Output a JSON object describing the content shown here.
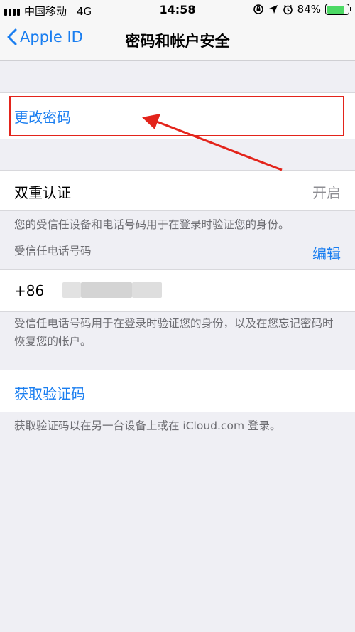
{
  "status_bar": {
    "carrier": "中国移动",
    "network": "4G",
    "time": "14:58",
    "battery_percent": "84%",
    "battery_level": 0.84
  },
  "nav": {
    "back_label": "Apple ID",
    "title": "密码和帐户安全"
  },
  "change_password": {
    "label": "更改密码"
  },
  "two_factor": {
    "label": "双重认证",
    "status": "开启",
    "note": "您的受信任设备和电话号码用于在登录时验证您的身份。"
  },
  "trusted_phone": {
    "header": "受信任电话号码",
    "edit_label": "编辑",
    "number_prefix": "+86",
    "note": "受信任电话号码用于在登录时验证您的身份，以及在您忘记密码时恢复您的帐户。"
  },
  "verification_code": {
    "label": "获取验证码",
    "note": "获取验证码以在另一台设备上或在 iCloud.com 登录。"
  },
  "colors": {
    "accent": "#1a7ef0",
    "highlight": "#e3241b",
    "background": "#efeff4"
  }
}
